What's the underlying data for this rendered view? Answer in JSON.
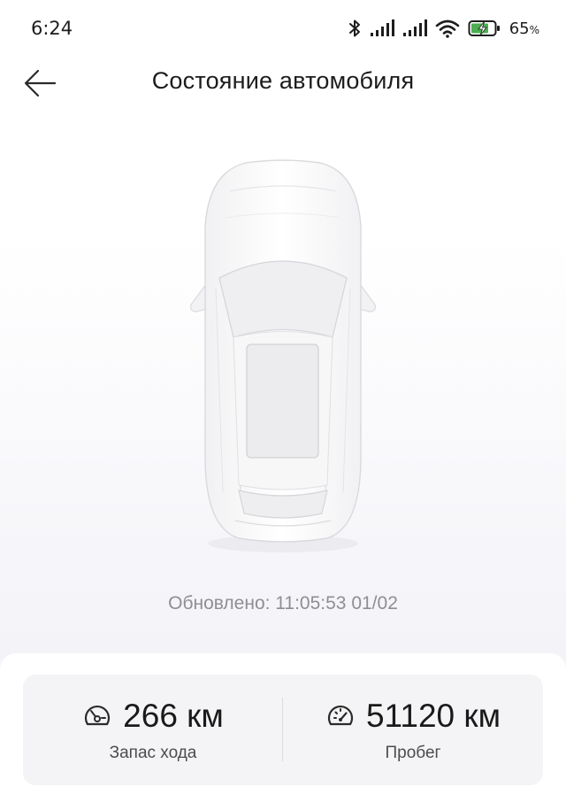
{
  "status_bar": {
    "time": "6:24",
    "battery_percent": "65",
    "battery_unit": "%",
    "icons": [
      "bluetooth-icon",
      "signal-icon",
      "signal-icon",
      "wifi-icon",
      "battery-charging-icon"
    ],
    "battery_color": "#4caf50"
  },
  "header": {
    "back_icon": "arrow-left-icon",
    "title": "Состояние автомобиля"
  },
  "vehicle": {
    "updated": "Обновлено: 11:05:53 01/02"
  },
  "stats": {
    "range": {
      "icon": "gauge-icon",
      "value": "266 км",
      "label": "Запас хода"
    },
    "mileage": {
      "icon": "speedometer-icon",
      "value": "51120 км",
      "label": "Пробег"
    }
  }
}
